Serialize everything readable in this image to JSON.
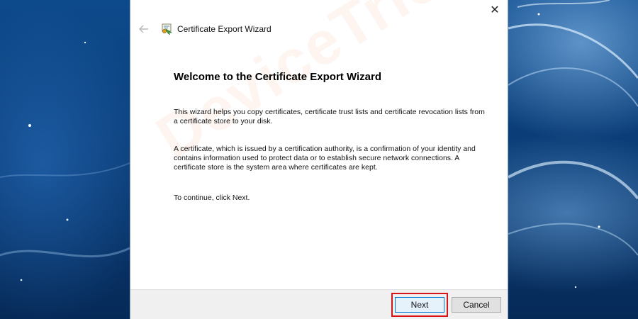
{
  "window": {
    "title": "Certificate Export Wizard",
    "close_glyph": "✕",
    "back_icon": "back-arrow-icon",
    "wizard_icon": "certificate-icon"
  },
  "content": {
    "heading": "Welcome to the Certificate Export Wizard",
    "paragraph1": "This wizard helps you copy certificates, certificate trust lists and certificate revocation lists from a certificate store to your disk.",
    "paragraph2": "A certificate, which is issued by a certification authority, is a confirmation of your identity and contains information used to protect data or to establish secure network connections. A certificate store is the system area where certificates are kept.",
    "paragraph3": "To continue, click Next."
  },
  "footer": {
    "next_label": "Next",
    "cancel_label": "Cancel"
  },
  "watermark": "DeviceTricks",
  "colors": {
    "highlight": "#d8141b",
    "next_border": "#0078d7",
    "desktop": "#0b3f7a"
  }
}
